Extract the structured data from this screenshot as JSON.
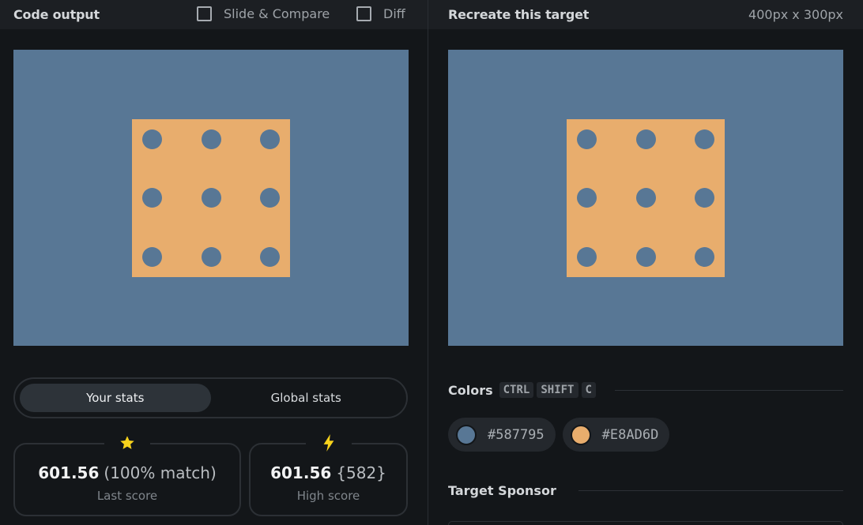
{
  "left_panel": {
    "title": "Code output",
    "slide_compare_label": "Slide & Compare",
    "diff_label": "Diff"
  },
  "right_panel": {
    "title": "Recreate this target",
    "dimensions": "400px x 300px"
  },
  "colors": {
    "canvas_background": "#587795",
    "square_fill": "#E8AD6D",
    "dot_fill": "#587795"
  },
  "stats": {
    "tabs": [
      "Your stats",
      "Global stats"
    ],
    "active_tab": "Your stats",
    "last_score": {
      "icon": "star-icon",
      "value": "601.56",
      "extra": "(100% match)",
      "label": "Last score"
    },
    "high_score": {
      "icon": "lightning-icon",
      "value": "601.56",
      "extra": "{582}",
      "label": "High score"
    }
  },
  "colors_section": {
    "title": "Colors",
    "shortcut_keys": [
      "CTRL",
      "SHIFT",
      "C"
    ],
    "swatches": [
      {
        "hex": "#587795"
      },
      {
        "hex": "#E8AD6D"
      }
    ]
  },
  "sponsor_section": {
    "title": "Target Sponsor"
  }
}
